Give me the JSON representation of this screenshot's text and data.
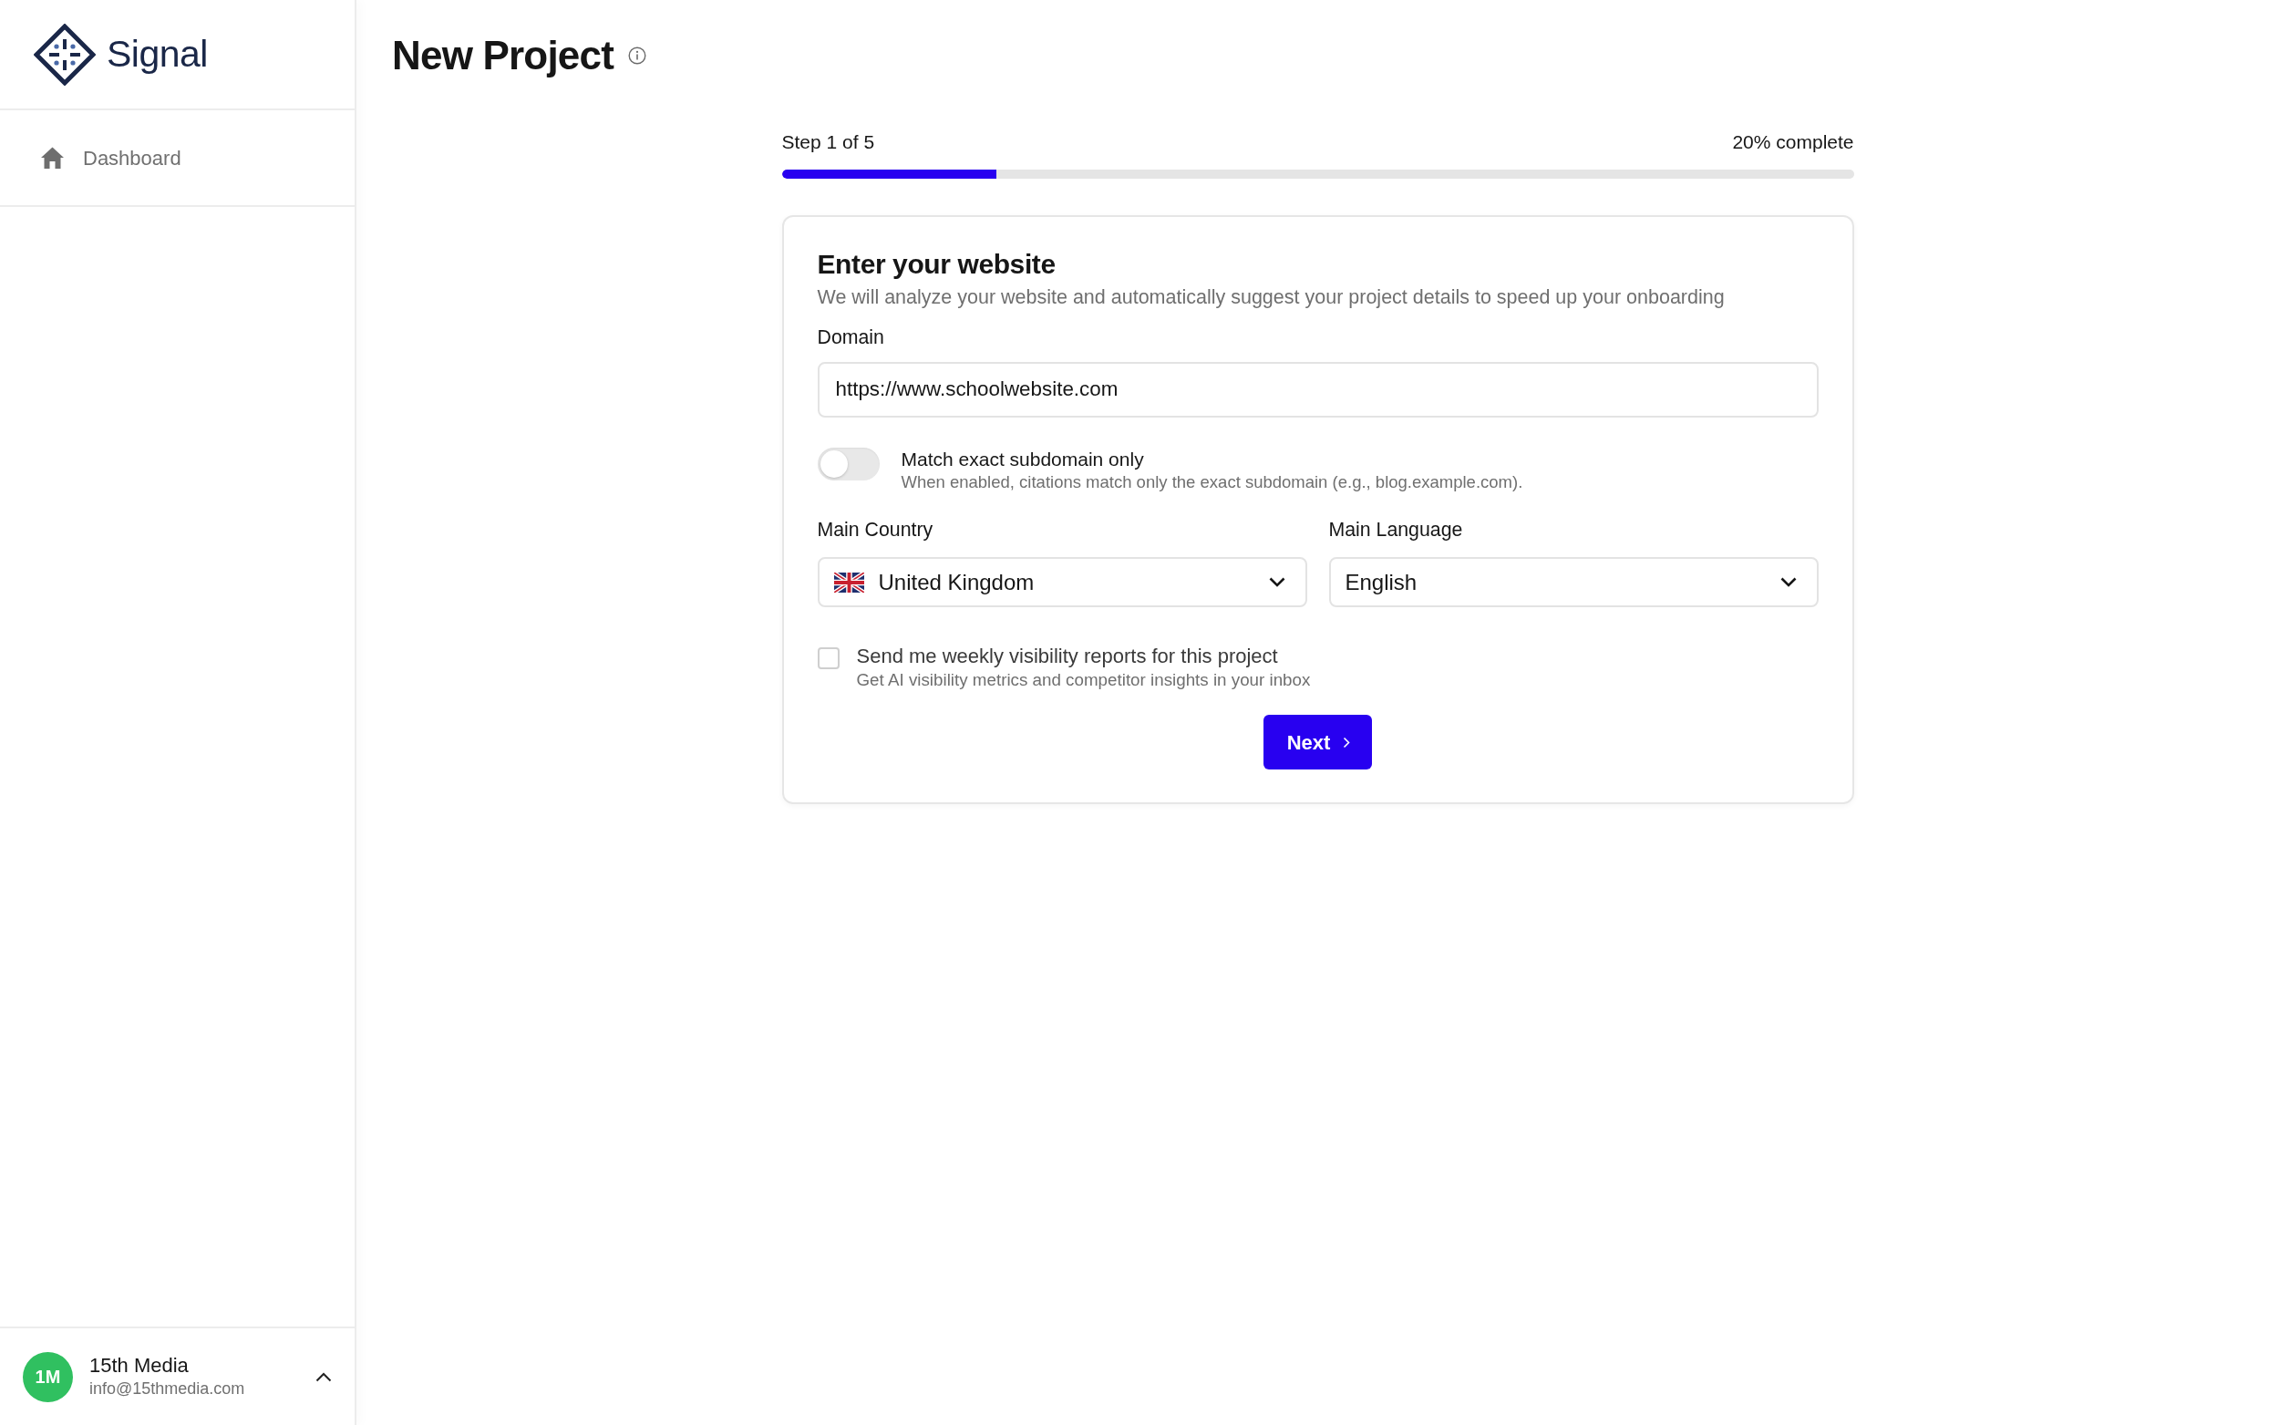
{
  "sidebar": {
    "logo": {
      "text": "Signal"
    },
    "items": [
      {
        "label": "Dashboard",
        "selected": false
      }
    ],
    "user": {
      "initials": "1M",
      "name": "15th Media",
      "email": "info@15thmedia.com"
    }
  },
  "page": {
    "title": "New Project"
  },
  "progress": {
    "step_label": "Step 1 of 5",
    "percent_label": "20% complete",
    "level": 0.2
  },
  "card": {
    "title": "Enter your website",
    "description": "We will analyze your website and automatically suggest your project details to speed up your onboarding",
    "domain": {
      "label": "Domain",
      "value": "https://www.schoolwebsite.com"
    },
    "subdomain_toggle": {
      "label": "Match exact subdomain only",
      "hint": "When enabled, citations match only the exact subdomain (e.g., blog.example.com).",
      "on": false
    },
    "country": {
      "label": "Main Country",
      "value": "United Kingdom"
    },
    "language": {
      "label": "Main Language",
      "value": "English"
    },
    "weekly_reports": {
      "label": "Send me weekly visibility reports for this project",
      "hint": "Get AI visibility metrics and competitor insights in your inbox",
      "checked": false
    },
    "next_button": {
      "label": "Next"
    }
  }
}
